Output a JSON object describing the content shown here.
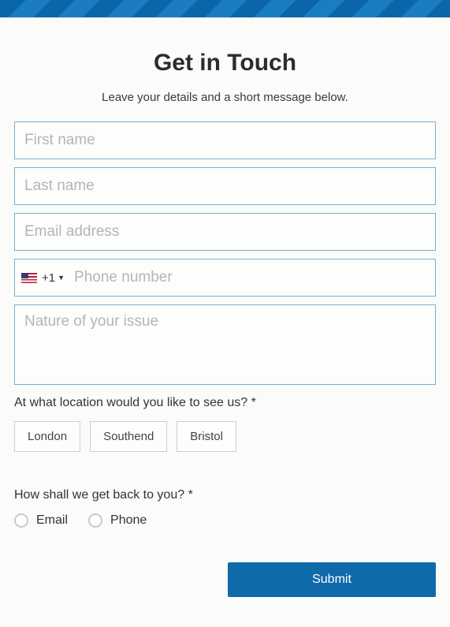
{
  "title": "Get in Touch",
  "subtitle": "Leave your details and a short message below.",
  "fields": {
    "first_name": {
      "placeholder": "First name",
      "value": ""
    },
    "last_name": {
      "placeholder": "Last name",
      "value": ""
    },
    "email": {
      "placeholder": "Email address",
      "value": ""
    },
    "phone": {
      "placeholder": "Phone number",
      "value": "",
      "dial_code": "+1"
    },
    "message": {
      "placeholder": "Nature of your issue",
      "value": ""
    }
  },
  "location_question": "At what location would you like to see us? *",
  "locations": [
    "London",
    "Southend",
    "Bristol"
  ],
  "contact_question": "How shall we get back to you? *",
  "contact_options": [
    "Email",
    "Phone"
  ],
  "submit_label": "Submit"
}
